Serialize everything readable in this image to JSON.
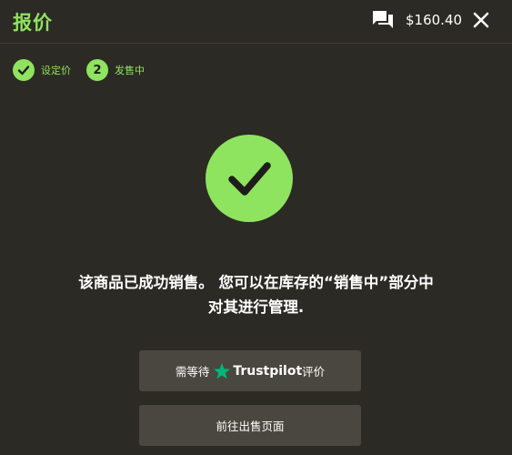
{
  "header": {
    "title": "报价",
    "balance": "$160.40",
    "chat_icon": "chat-bubbles-icon",
    "close_icon": "close-icon"
  },
  "steps": [
    {
      "label": "设定价",
      "state": "completed",
      "marker": "check"
    },
    {
      "number": "2",
      "label": "发售中",
      "state": "current"
    }
  ],
  "success": {
    "icon": "check-circle-icon",
    "message_line1": "该商品已成功销售。 您可以在库存的“销售中”部分中",
    "message_line2": "对其进行管理."
  },
  "buttons": {
    "review": {
      "prefix": "需等待",
      "brand": "Trustpilot",
      "suffix": "评价"
    },
    "sales_page": {
      "label": "前往出售页面"
    }
  },
  "colors": {
    "accent": "#8ee35f",
    "background": "#2c2a24",
    "button_bg": "#4a4740",
    "trustpilot_star": "#00b67a"
  }
}
